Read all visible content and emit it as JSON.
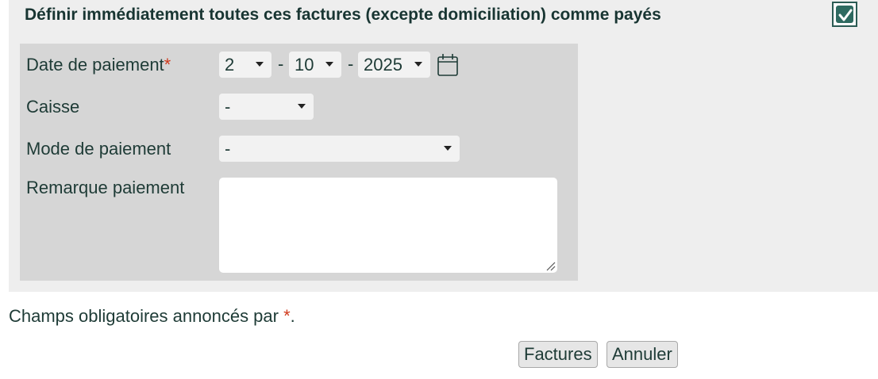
{
  "heading": "Définir immédiatement toutes ces factures (excepte domiciliation) comme payés",
  "mark_paid_checked": true,
  "form": {
    "date_label": "Date de paiement",
    "required_marker": "*",
    "day_value": "2",
    "date_separator": "-",
    "month_value": "10",
    "year_value": "2025",
    "calendar_icon": "calendar-icon",
    "caisse_label": "Caisse",
    "caisse_value": "-",
    "mode_label": "Mode de paiement",
    "mode_value": "-",
    "remark_label": "Remarque paiement",
    "remark_value": ""
  },
  "footer": {
    "note_text": "Champs obligatoires annoncés par ",
    "note_marker": "*",
    "note_end": "."
  },
  "buttons": {
    "submit_label": "Factures",
    "cancel_label": "Annuler"
  },
  "colors": {
    "accent": "#2e6a60",
    "required": "#d03a1c",
    "panel": "#eeeeee",
    "form_box": "#d6d6d6"
  }
}
